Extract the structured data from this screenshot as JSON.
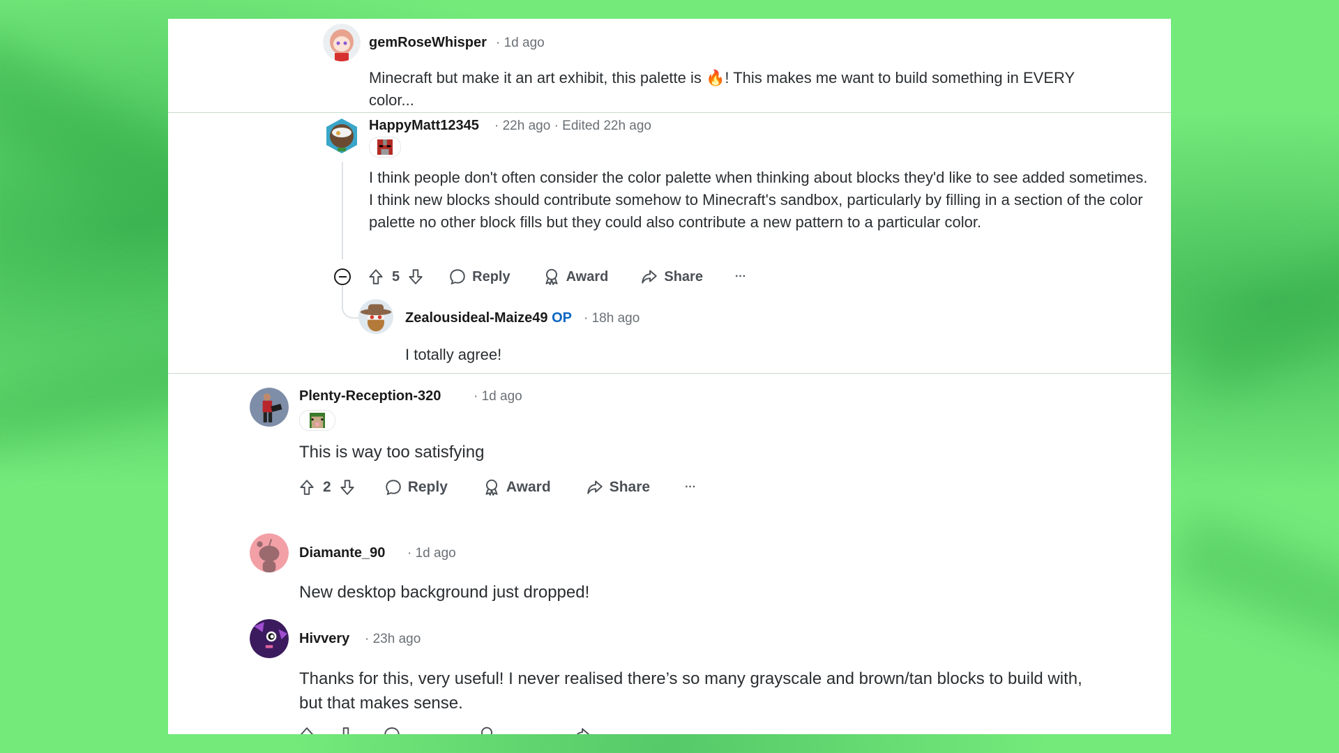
{
  "background": {
    "accent": "#74ea7b"
  },
  "comments": {
    "gem": {
      "username": "gemRoseWhisper",
      "meta": "· 1d ago",
      "body_line1": "Minecraft but make it an art exhibit, this palette is 🔥! This makes me want to build something in EVERY",
      "body_line2": "color...",
      "avatar_icon": "anime-girl-avatar"
    },
    "happy": {
      "username": "HappyMatt12345",
      "meta": "· 22h ago · Edited 22h ago",
      "flair_icon": "mooshroom-flair",
      "body": "I think people don't often consider the color palette when thinking about blocks they'd like to see added sometimes. I think new blocks should contribute somehow to Minecraft's sandbox, particularly by filling in a section of the color palette no other block fills but they could also contribute a new pattern to a particular color.",
      "votes": "5",
      "actions": {
        "reply": "Reply",
        "award": "Award",
        "share": "Share",
        "more": "···"
      }
    },
    "zealous": {
      "username": "Zealousideal-Maize49",
      "op_badge": "OP",
      "meta": "· 18h ago",
      "body": "I totally agree!"
    },
    "plenty": {
      "username": "Plenty-Reception-320",
      "meta": "· 1d ago",
      "flair_icon": "sheep-flair",
      "body": "This is way too satisfying",
      "votes": "2",
      "actions": {
        "reply": "Reply",
        "award": "Award",
        "share": "Share",
        "more": "···"
      }
    },
    "diamante": {
      "username": "Diamante_90",
      "meta": "· 1d ago",
      "body": "New desktop background just dropped!"
    },
    "hivvery": {
      "username": "Hivvery",
      "meta": "· 23h ago",
      "body_line1": "Thanks for this, very useful! I never realised there’s so many grayscale and brown/tan blocks to build with,",
      "body_line2": "but that makes sense."
    }
  }
}
